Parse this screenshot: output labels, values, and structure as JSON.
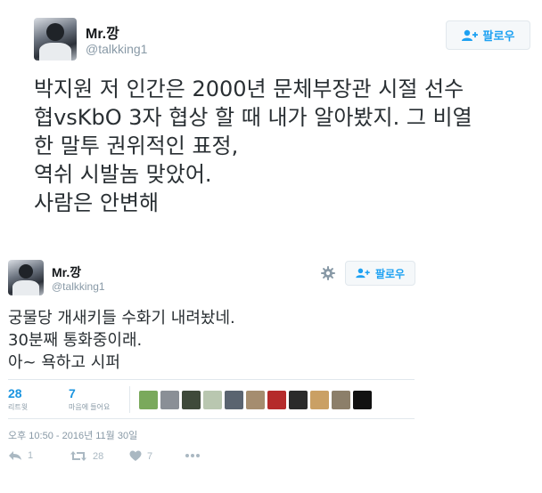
{
  "tweet1": {
    "name": "Mr.깡",
    "handle": "@talkking1",
    "follow_label": "팔로우",
    "text_lines": [
      "박지원 저 인간은 2000년 문체부장관 시절 선수",
      "협vsKbO 3자 협상 할 때 내가 알아봤지. 그 비열",
      "한 말투 권위적인 표정,",
      "역쉬 시발놈 맞았어.",
      "사람은 안변해"
    ]
  },
  "tweet2": {
    "name": "Mr.깡",
    "handle": "@talkking1",
    "follow_label": "팔로우",
    "text_lines": [
      "궁물당 개새키들 수화기 내려놨네.",
      "30분째 통화중이래.",
      "아~ 욕하고 시퍼"
    ],
    "retweets": {
      "count": "28",
      "label": "리트윗"
    },
    "likes": {
      "count": "7",
      "label": "마음에 들어요"
    },
    "liker_colors": [
      "#7aa95c",
      "#8a8f96",
      "#3f4a3a",
      "#b9c7b0",
      "#5a6470",
      "#a58d6f",
      "#b52b2b",
      "#2b2b2b",
      "#caa064",
      "#8c7f6a",
      "#111111"
    ],
    "timestamp": "오후 10:50 - 2016년 11월 30일",
    "actions": {
      "reply_count": "1",
      "retweet_count": "28",
      "like_count": "7"
    }
  },
  "colors": {
    "accent": "#1da1f2",
    "muted": "#8899a6"
  }
}
